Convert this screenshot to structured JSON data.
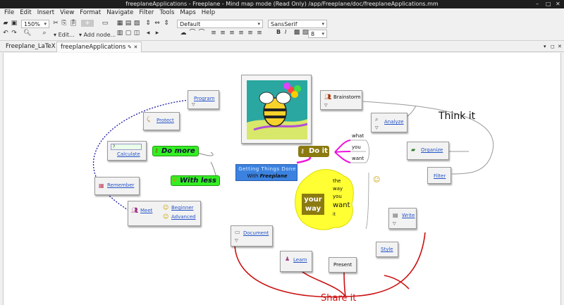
{
  "window": {
    "app_label": "",
    "title": "freeplaneApplications - Freeplane - Mind map mode (Read Only) /app/Freeplane/doc/freeplaneApplications.mm"
  },
  "menu": [
    "File",
    "Edit",
    "Insert",
    "View",
    "Format",
    "Navigate",
    "Filter",
    "Tools",
    "Maps",
    "Help"
  ],
  "toolbar": {
    "zoom": "150%",
    "edit_label": "Edit...",
    "add_node_label": "Add node...",
    "style_value": "Default",
    "font_value": "SansSerif",
    "font_size": "8",
    "bold": "B",
    "italic": "I"
  },
  "tabs": [
    {
      "label": "Freeplane_LaTeX"
    },
    {
      "label": "freeplaneApplications",
      "close": "✕"
    }
  ],
  "map": {
    "center": {
      "title": "Getting Things Done",
      "subtitle_prefix": "With ",
      "subtitle_brand": "Freeplane"
    },
    "program": "Program",
    "protect": "Protect",
    "calculate_input": "?",
    "calculate": "Calculate",
    "remember": "Remember",
    "meet": "Meet",
    "beginner": "Beginner",
    "advanced": "Advanced",
    "do_more": "Do more",
    "with_less": "With less",
    "do_it": "Do it",
    "what": "what",
    "you": "you",
    "want": "want",
    "your_way": [
      "your",
      "way"
    ],
    "the_way_stack": [
      "the",
      "way",
      "you",
      "want",
      "it"
    ],
    "brainstorm": "Brainstorm",
    "analyze": "Analyze",
    "organize": "Organize",
    "filter": "Filter",
    "think_it": "Think it",
    "write": "Write",
    "style": "Style",
    "present": "Present",
    "learn": "Learn",
    "document": "Document",
    "share_it": "Share it"
  },
  "colors": {
    "green_node": "#33ee22",
    "do_it_bg": "#8b7a10",
    "yellow_blob": "#ffff33",
    "share_line": "#cc1111",
    "center_bg": "#3b82e0",
    "magenta_line": "#ee11dd"
  }
}
